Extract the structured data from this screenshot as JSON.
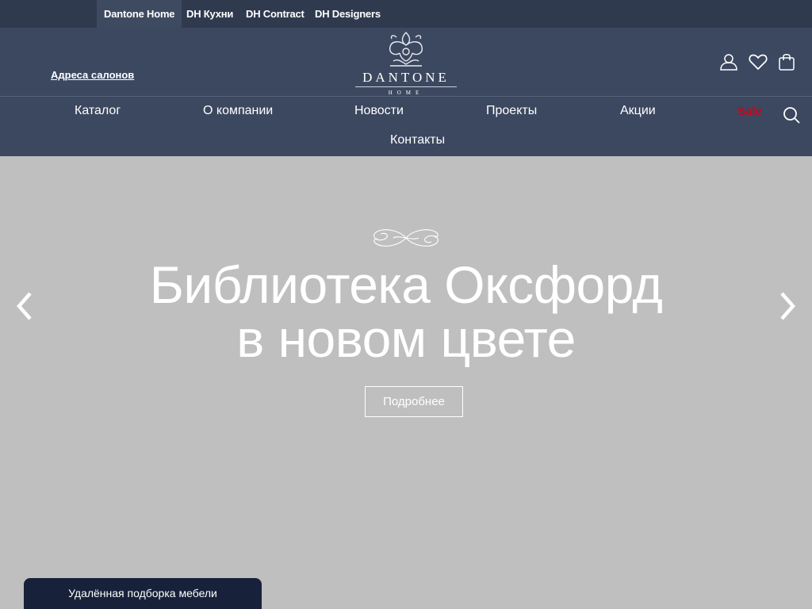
{
  "topbar": {
    "tabs": [
      {
        "label": "Dantone Home",
        "active": true
      },
      {
        "label": "DH Кухни",
        "active": false
      },
      {
        "label": "DH Contract",
        "active": false
      },
      {
        "label": "DH Designers",
        "active": false
      }
    ]
  },
  "header": {
    "salons_link": "Адреса салонов",
    "logo": {
      "main": "DANTONE",
      "sub": "HOME"
    },
    "icons": [
      "user-icon",
      "heart-icon",
      "shopping-bag-icon"
    ]
  },
  "nav": {
    "items": [
      "Каталог",
      "О компании",
      "Новости",
      "Проекты",
      "Акции",
      "Sale",
      "Контакты"
    ],
    "search_icon": "search-icon"
  },
  "hero": {
    "title_line1": "Библиотека Оксфорд",
    "title_line2": "в новом цвете",
    "button_label": "Подробнее",
    "prev_icon": "chevron-left-icon",
    "next_icon": "chevron-right-icon"
  },
  "widget": {
    "label": "Удалённая подборка мебели"
  },
  "colors": {
    "topbar": "#2f3a4f",
    "header": "#3c4860",
    "hero_bg": "#bfbfbf",
    "sale": "#d0021b",
    "widget": "#17223a"
  }
}
